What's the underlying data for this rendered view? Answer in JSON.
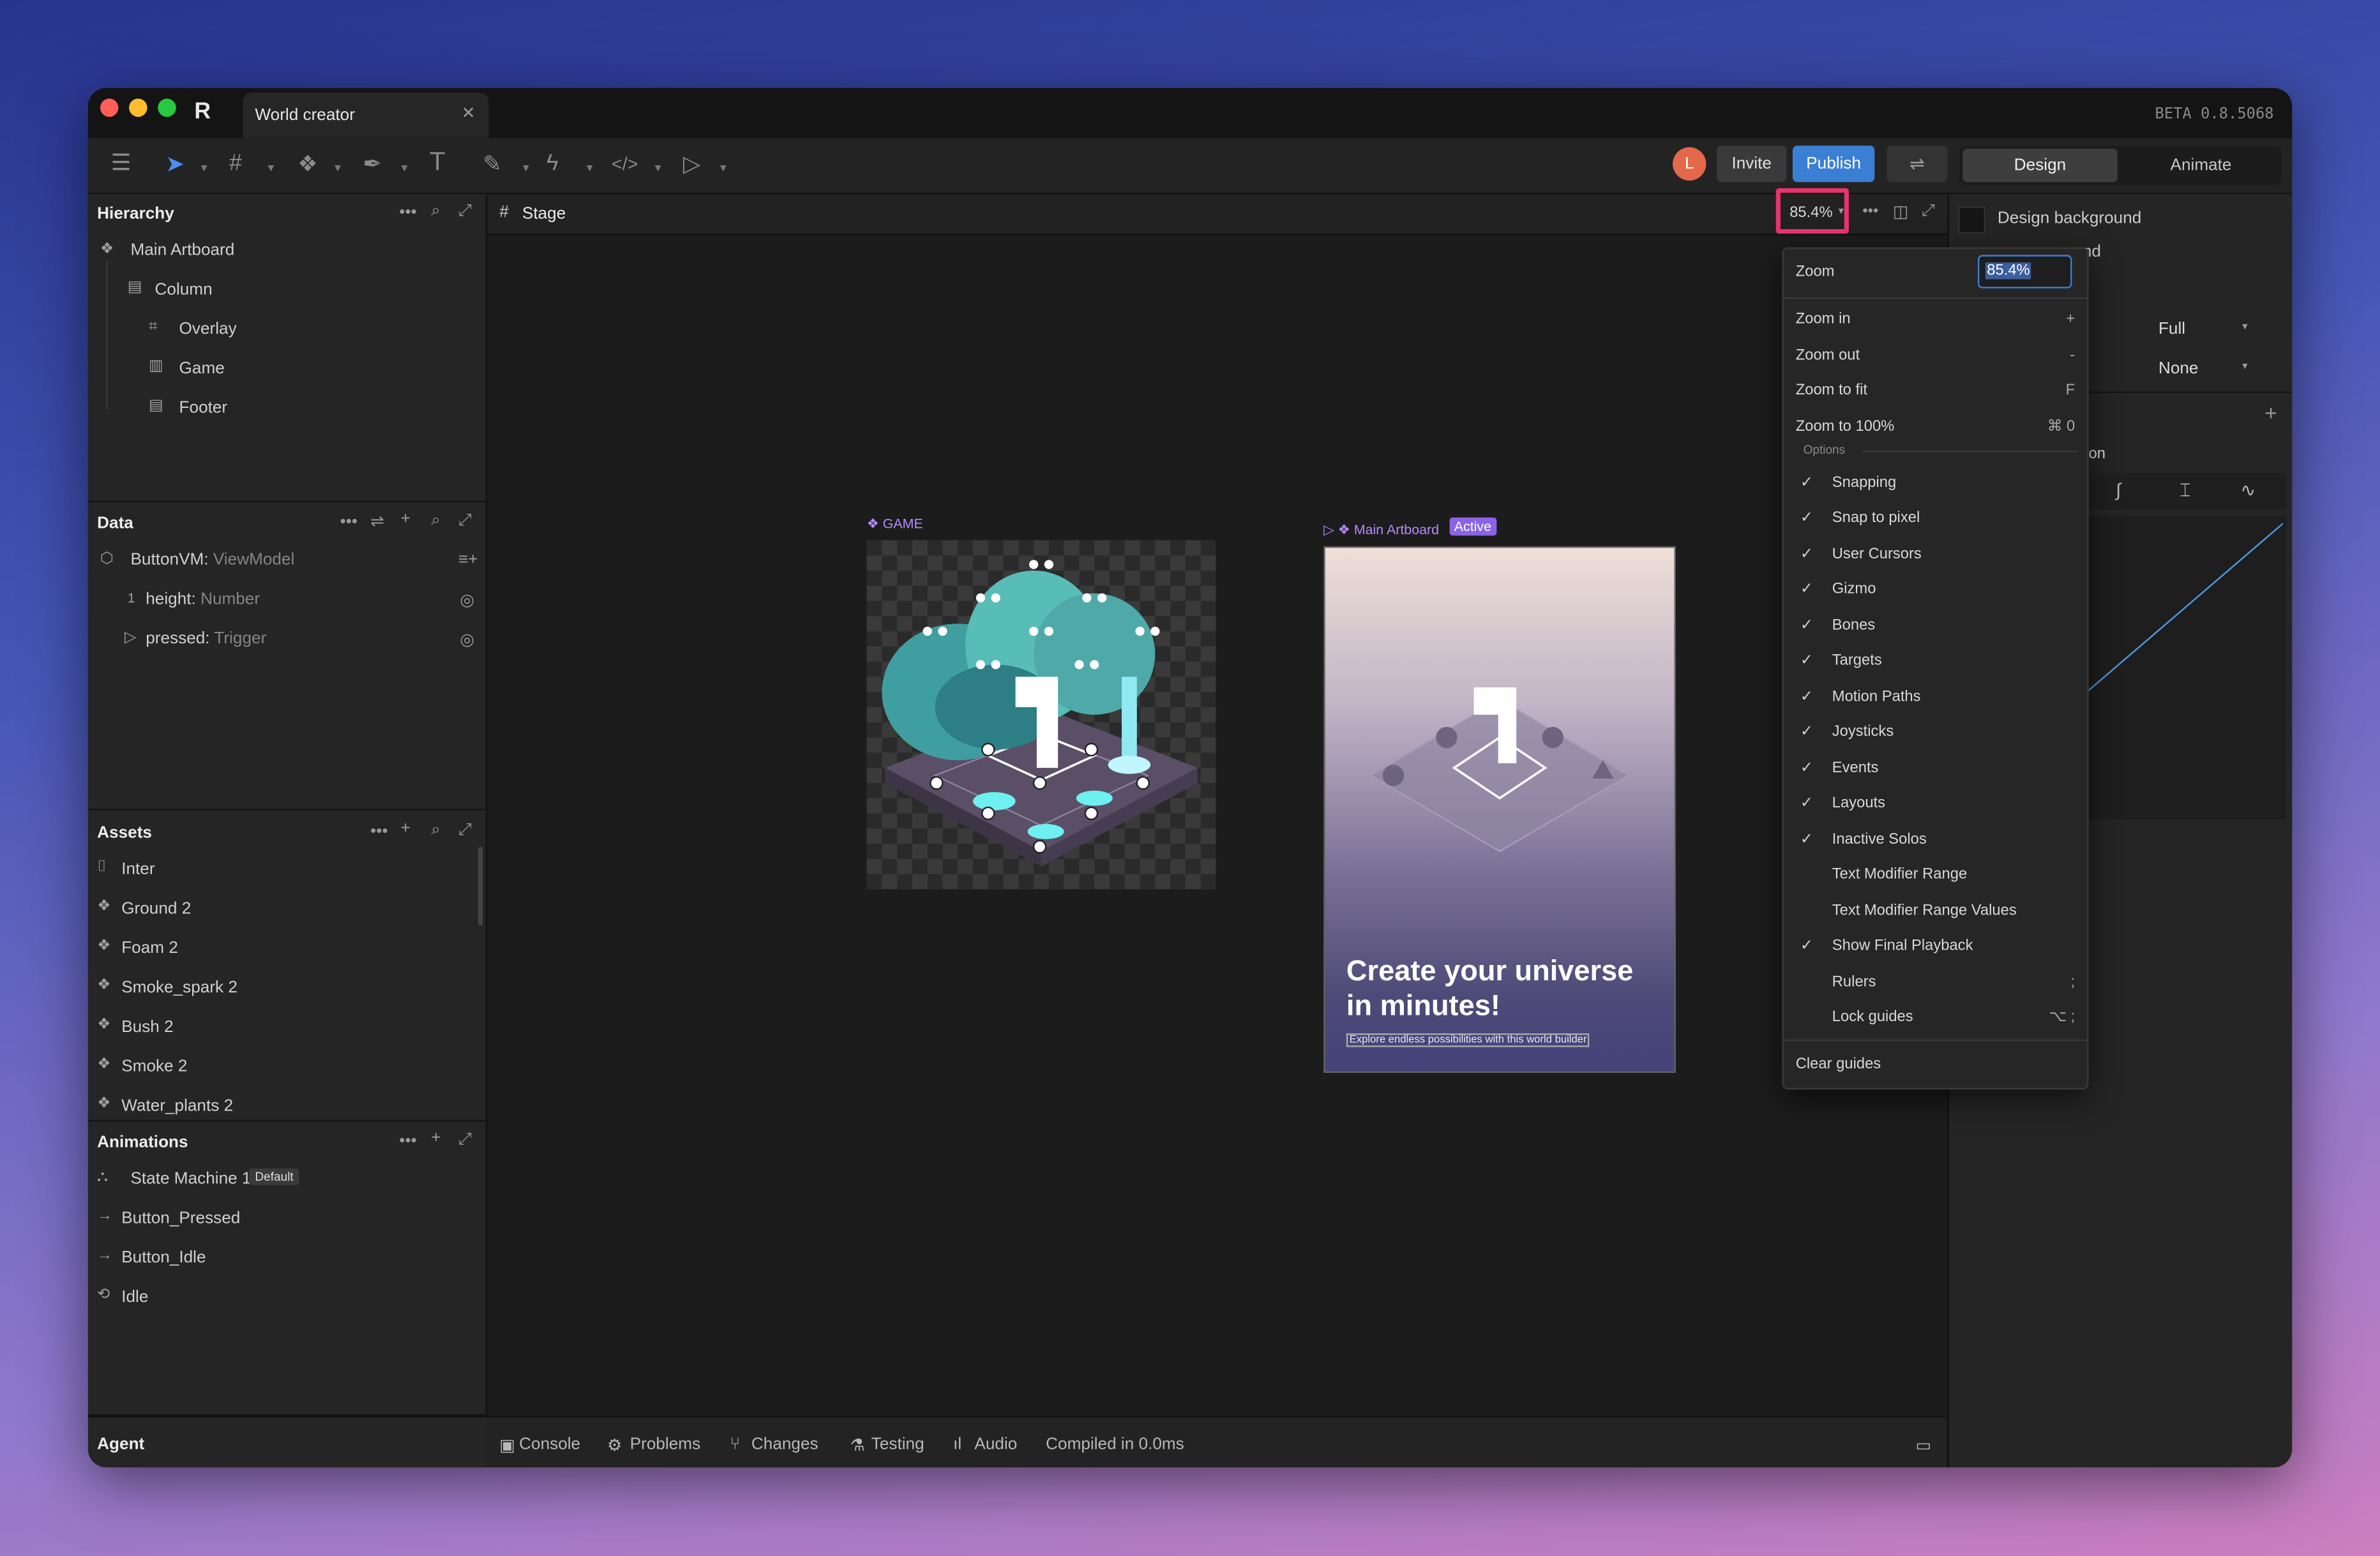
{
  "window": {
    "tab_title": "World creator",
    "version": "BETA 0.8.5068"
  },
  "toolbar": {
    "avatar_letter": "L",
    "invite_label": "Invite",
    "publish_label": "Publish",
    "mode_tabs": [
      "Design",
      "Animate"
    ]
  },
  "hierarchy": {
    "title": "Hierarchy",
    "items": [
      "Main Artboard",
      "Column",
      "Overlay",
      "Game",
      "Footer"
    ]
  },
  "data_panel": {
    "title": "Data",
    "viewmodel_name": "ButtonVM:",
    "viewmodel_type": "ViewModel",
    "props": [
      {
        "index": "1",
        "name": "height:",
        "type": "Number"
      },
      {
        "name": "pressed:",
        "type": "Trigger"
      }
    ]
  },
  "assets": {
    "title": "Assets",
    "items": [
      "Inter",
      "Ground 2",
      "Foam 2",
      "Smoke_spark 2",
      "Bush 2",
      "Smoke 2",
      "Water_plants 2"
    ]
  },
  "animations": {
    "title": "Animations",
    "items": [
      "State Machine 1",
      "Button_Pressed",
      "Button_Idle",
      "Idle"
    ],
    "default_badge": "Default"
  },
  "agent_label": "Agent",
  "stage": {
    "tab_label": "Stage",
    "zoom_value": "85.4%",
    "game_label": "GAME",
    "artboard_label": "Main Artboard",
    "active_badge": "Active",
    "headline": "Create your universe in minutes!",
    "subline": "Explore endless possibilities with this world builder"
  },
  "zoom_menu": {
    "zoom_label": "Zoom",
    "zoom_input": "85.4%",
    "actions": [
      {
        "label": "Zoom in",
        "shortcut": "+"
      },
      {
        "label": "Zoom out",
        "shortcut": "-"
      },
      {
        "label": "Zoom to fit",
        "shortcut": "F"
      },
      {
        "label": "Zoom to 100%",
        "shortcut": "⌘ 0"
      }
    ],
    "options_header": "Options",
    "options": [
      {
        "label": "Snapping",
        "checked": true,
        "shortcut": ""
      },
      {
        "label": "Snap to pixel",
        "checked": true,
        "shortcut": ""
      },
      {
        "label": "User Cursors",
        "checked": true,
        "shortcut": ""
      },
      {
        "label": "Gizmo",
        "checked": true,
        "shortcut": ""
      },
      {
        "label": "Bones",
        "checked": true,
        "shortcut": ""
      },
      {
        "label": "Targets",
        "checked": true,
        "shortcut": ""
      },
      {
        "label": "Motion Paths",
        "checked": true,
        "shortcut": ""
      },
      {
        "label": "Joysticks",
        "checked": true,
        "shortcut": ""
      },
      {
        "label": "Events",
        "checked": true,
        "shortcut": ""
      },
      {
        "label": "Layouts",
        "checked": true,
        "shortcut": ""
      },
      {
        "label": "Inactive Solos",
        "checked": true,
        "shortcut": ""
      },
      {
        "label": "Text Modifier Range",
        "checked": false,
        "shortcut": ""
      },
      {
        "label": "Text Modifier Range Values",
        "checked": false,
        "shortcut": ""
      },
      {
        "label": "Show Final Playback",
        "checked": true,
        "shortcut": ""
      },
      {
        "label": "Rulers",
        "checked": false,
        "shortcut": ";"
      },
      {
        "label": "Lock guides",
        "checked": false,
        "shortcut": "⌥ ;"
      }
    ],
    "clear_guides": "Clear guides"
  },
  "right_panel": {
    "design_background": "Design background",
    "animate_background_partial": "round",
    "fit_value": "Full",
    "align_value": "None",
    "section_partial": "on"
  },
  "bottom_bar": {
    "tabs": [
      "Console",
      "Problems",
      "Changes",
      "Testing",
      "Audio"
    ],
    "status": "Compiled in 0.0ms"
  },
  "colors": {
    "accent_blue": "#3b7fd4",
    "highlight_pink": "#e8336e",
    "badge_purple": "#8a63e6",
    "avatar": "#e4694a"
  }
}
